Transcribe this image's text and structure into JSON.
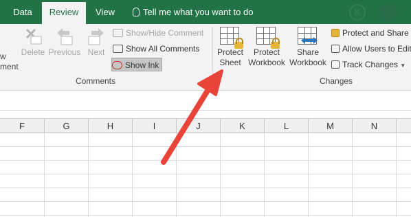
{
  "tabs": [
    {
      "label": "Data"
    },
    {
      "label": "Review"
    },
    {
      "label": "View"
    }
  ],
  "tell_me": {
    "label": "Tell me what you want to do"
  },
  "ribbon": {
    "comments": {
      "new_label_partial_1": "w",
      "new_label_partial_2": "ment",
      "delete_label": "Delete",
      "previous_label": "Previous",
      "next_label": "Next",
      "show_hide_label": "Show/Hide Comment",
      "show_all_label": "Show All Comments",
      "show_ink_label": "Show Ink",
      "group_label": "Comments"
    },
    "changes": {
      "protect_sheet_line1": "Protect",
      "protect_sheet_line2": "Sheet",
      "protect_workbook_line1": "Protect",
      "protect_workbook_line2": "Workbook",
      "share_workbook_line1": "Share",
      "share_workbook_line2": "Workbook",
      "protect_and_share_label": "Protect and Share W",
      "allow_users_label": "Allow Users to Edit",
      "track_changes_label": "Track Changes",
      "group_label": "Changes"
    }
  },
  "columns": [
    "F",
    "G",
    "H",
    "I",
    "J",
    "K",
    "L",
    "M",
    "N"
  ],
  "colors": {
    "brand_green": "#217346",
    "arrow_red": "#e8443a"
  }
}
